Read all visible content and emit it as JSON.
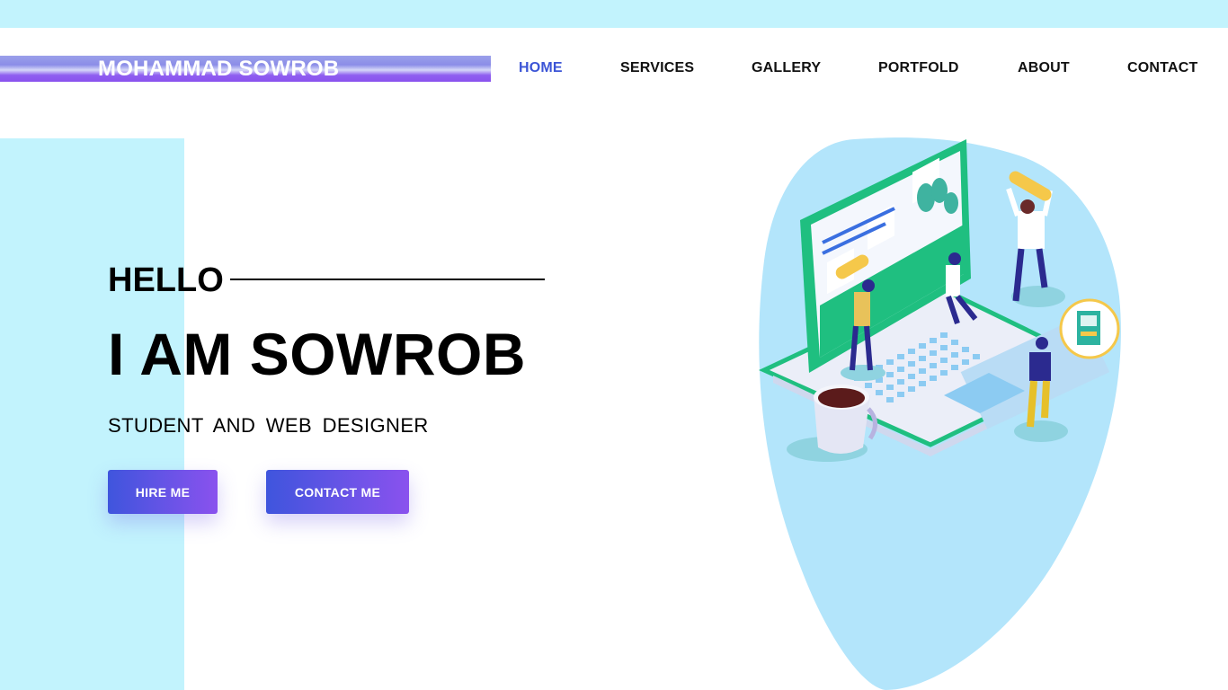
{
  "brand": {
    "name": "MOHAMMAD SOWROB"
  },
  "nav": {
    "items": [
      {
        "label": "HOME",
        "active": true
      },
      {
        "label": "SERVICES"
      },
      {
        "label": "GALLERY"
      },
      {
        "label": "PORTFOLD"
      },
      {
        "label": "ABOUT"
      },
      {
        "label": "CONTACT"
      }
    ]
  },
  "hero": {
    "greeting": "HELLO",
    "title": "I AM SOWROB",
    "subtitle": "STUDENT AND WEB DESIGNER",
    "buttons": {
      "hire": "HIRE ME",
      "contact": "CONTACT ME"
    }
  },
  "colors": {
    "accent_light": "#c2f3fd",
    "nav_active": "#3b54d6",
    "button_gradient_start": "#3f55dd",
    "button_gradient_end": "#8a52ee",
    "blob": "#b3e5fb",
    "laptop_green": "#1fbf80"
  },
  "illustration": {
    "name": "laptop-team-illustration"
  }
}
